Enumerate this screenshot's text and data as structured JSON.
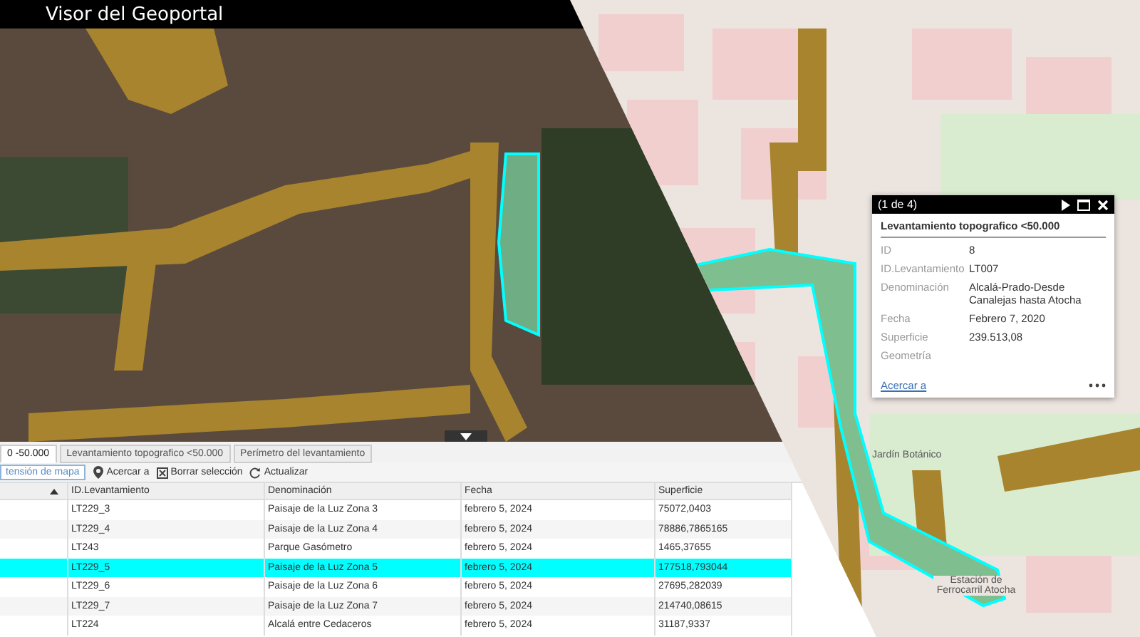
{
  "header": {
    "title": "Visor del Geoportal"
  },
  "tabs": [
    {
      "label": "0 -50.000",
      "selected": true
    },
    {
      "label": "Levantamiento topografico <50.000",
      "selected": false
    },
    {
      "label": "Perímetro del levantamiento",
      "selected": false
    }
  ],
  "toolbar": {
    "filter": "tensión de mapa",
    "actions": [
      {
        "kind": "zoom",
        "label": "Acercar a"
      },
      {
        "kind": "clear",
        "label": "Borrar selección"
      },
      {
        "kind": "refresh",
        "label": "Actualizar"
      }
    ]
  },
  "table": {
    "columns": [
      "ID.Levantamiento",
      "Denominación",
      "Fecha",
      "Superficie"
    ],
    "rows": [
      {
        "selected": false,
        "cells": [
          "LT229_3",
          "Paisaje de la Luz Zona 3",
          "febrero 5, 2024",
          "75072,0403"
        ]
      },
      {
        "selected": false,
        "cells": [
          "LT229_4",
          "Paisaje de la Luz Zona 4",
          "febrero 5, 2024",
          "78886,7865165"
        ]
      },
      {
        "selected": false,
        "cells": [
          "LT243",
          "Parque Gasómetro",
          "febrero 5, 2024",
          "1465,37655"
        ]
      },
      {
        "selected": true,
        "cells": [
          "LT229_5",
          "Paisaje de la Luz Zona 5",
          "febrero 5, 2024",
          "177518,793044"
        ]
      },
      {
        "selected": false,
        "cells": [
          "LT229_6",
          "Paisaje de la Luz Zona 6",
          "febrero 5, 2024",
          "27695,282039"
        ]
      },
      {
        "selected": false,
        "cells": [
          "LT229_7",
          "Paisaje de la Luz Zona 7",
          "febrero 5, 2024",
          "214740,08615"
        ]
      },
      {
        "selected": false,
        "cells": [
          "LT224",
          "Alcalá entre Cedaceros",
          "febrero 5, 2024",
          "31187,9337"
        ]
      }
    ]
  },
  "map_labels": [
    "Jardín Botánico",
    "Estación de Ferrocarril Atocha"
  ],
  "popup": {
    "counter": "(1 de 4)",
    "title": "Levantamiento topografico <50.000",
    "fields": [
      {
        "label": "ID",
        "value": "8"
      },
      {
        "label": "ID.Levantamiento",
        "value": "LT007"
      },
      {
        "label": "Denominación",
        "value": "Alcalá-Prado-Desde Canalejas hasta Atocha"
      },
      {
        "label": "Fecha",
        "value": "Febrero 7, 2020"
      },
      {
        "label": "Superficie",
        "value": "239.513,08"
      },
      {
        "label": "Geometría"
      }
    ],
    "link": "Acercar a"
  }
}
